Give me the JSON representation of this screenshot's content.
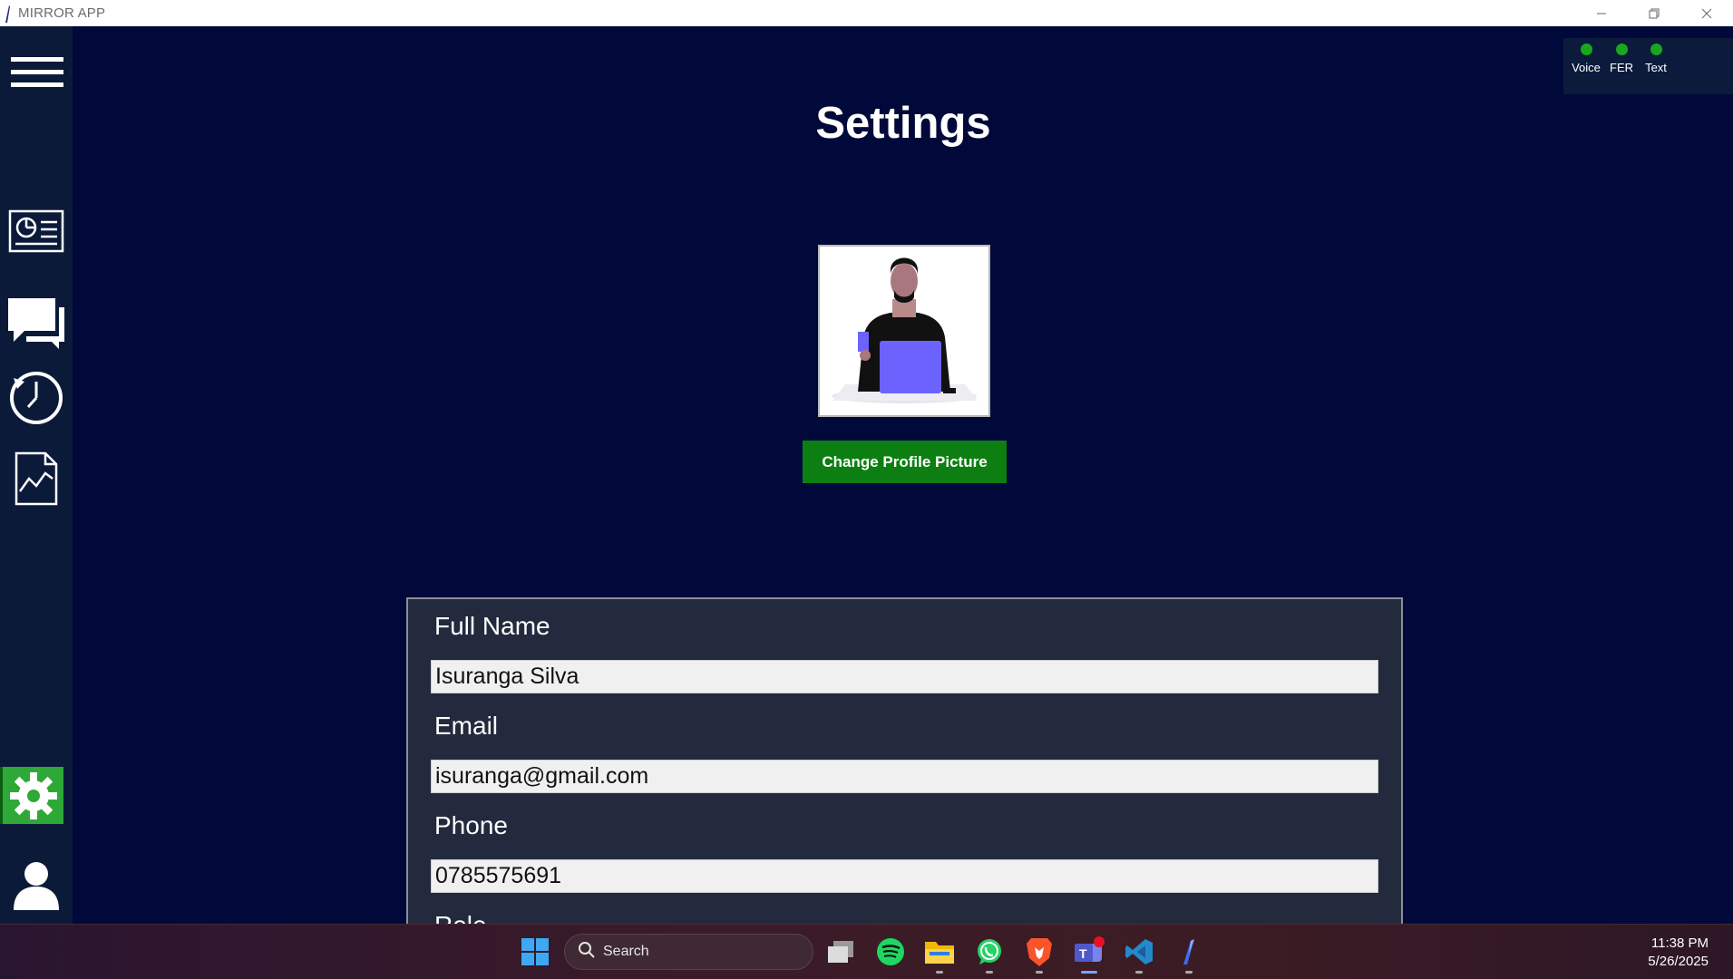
{
  "window": {
    "title": "MIRROR APP",
    "controls": [
      "minimize-icon",
      "restore-icon",
      "close-icon"
    ]
  },
  "sidebar": {
    "items": [
      {
        "name": "menu",
        "icon": "hamburger-menu-icon"
      },
      {
        "name": "dashboard",
        "icon": "dashboard-icon"
      },
      {
        "name": "chat",
        "icon": "chat-icon"
      },
      {
        "name": "history",
        "icon": "clock-history-icon"
      },
      {
        "name": "reports",
        "icon": "report-chart-icon"
      },
      {
        "name": "settings",
        "icon": "gear-icon",
        "active": true
      },
      {
        "name": "profile",
        "icon": "user-icon"
      }
    ],
    "active_color": "#2ea836"
  },
  "status": {
    "items": [
      {
        "label": "Voice",
        "color": "#19a71b"
      },
      {
        "label": "FER",
        "color": "#19a71b"
      },
      {
        "label": "Text",
        "color": "#19a71b"
      }
    ]
  },
  "main": {
    "title": "Settings",
    "change_picture_label": "Change Profile Picture",
    "button_color": "#0d7f12"
  },
  "form": {
    "fields": [
      {
        "label": "Full Name",
        "value": "Isuranga Silva"
      },
      {
        "label": "Email",
        "value": "isuranga@gmail.com"
      },
      {
        "label": "Phone",
        "value": "0785575691"
      },
      {
        "label": "Role",
        "value": ""
      }
    ]
  },
  "taskbar": {
    "search_label": "Search",
    "apps": [
      "windows-start-icon",
      "task-view-icon",
      "spotify-icon",
      "file-explorer-icon",
      "whatsapp-icon",
      "brave-browser-icon",
      "teams-icon",
      "vscode-icon",
      "mirror-app-icon"
    ],
    "time": "11:38 PM",
    "date": "5/26/2025"
  }
}
